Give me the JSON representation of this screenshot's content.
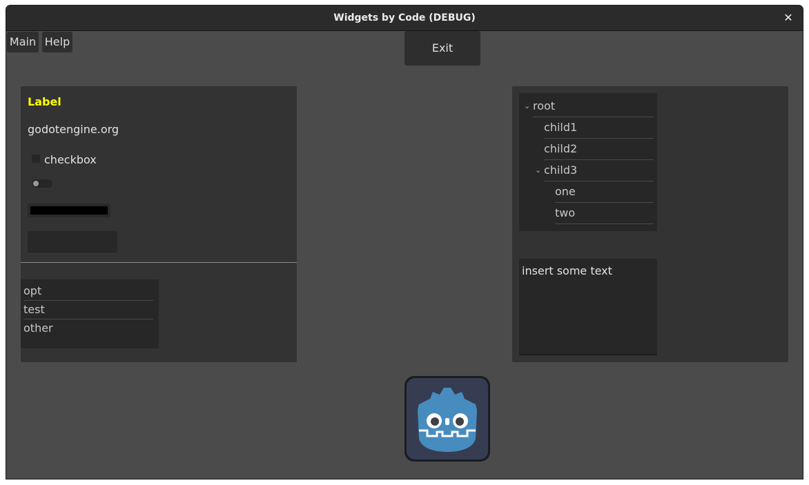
{
  "window": {
    "title": "Widgets by Code (DEBUG)"
  },
  "menu": {
    "main": "Main",
    "help": "Help"
  },
  "toolbar": {
    "exit": "Exit"
  },
  "left_panel": {
    "label": "Label",
    "link": "godotengine.org",
    "checkbox_label": "checkbox",
    "checkbox_checked": false,
    "toggle_on": false,
    "progress_fraction": 1.0,
    "list_items": [
      "opt",
      "test",
      "other"
    ]
  },
  "right_panel": {
    "tree": {
      "root": "root",
      "child1": "child1",
      "child2": "child2",
      "child3": "child3",
      "one": "one",
      "two": "two"
    },
    "text_edit": "insert some text"
  },
  "colors": {
    "background": "#4b4b4b",
    "panel": "#333333",
    "label_yellow": "#ffff00",
    "logo_blue": "#478cbf"
  },
  "icons": [
    "close-icon",
    "collapse-arrow-icon",
    "godot-logo"
  ]
}
